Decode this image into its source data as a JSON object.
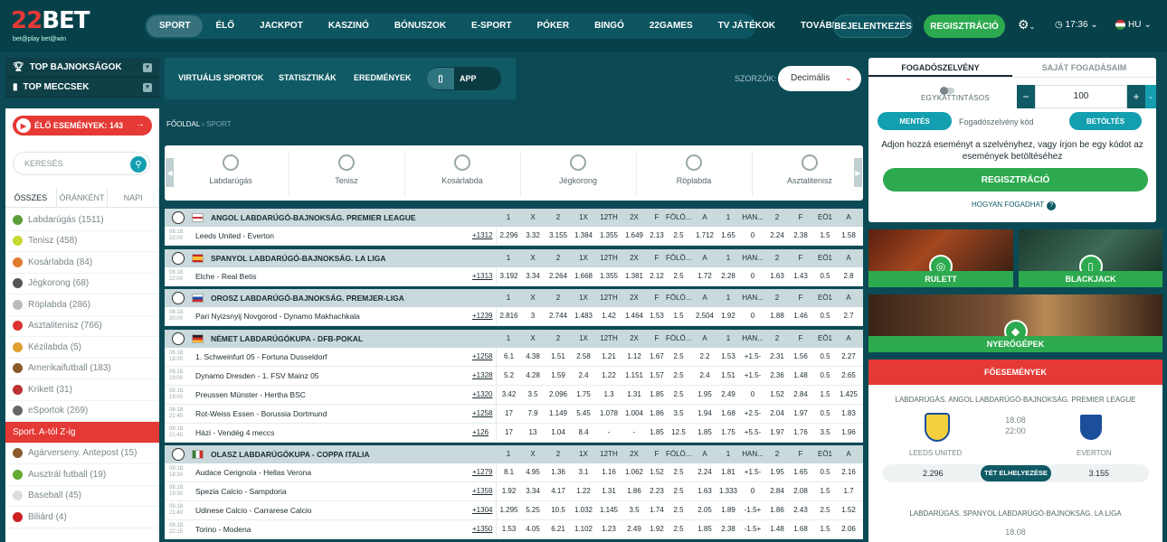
{
  "logo": {
    "text_z": "22",
    "text_bet": "BET",
    "tagline": "bet@play bet@win"
  },
  "nav": [
    "Sport",
    "Élő",
    "Jackpot",
    "Kaszinó",
    "Bónuszok",
    "E-Sport",
    "Póker",
    "Bingó",
    "22Games",
    "TV Játékok",
    "Tovább"
  ],
  "header": {
    "login": "BEJELENTKEZÉS",
    "register": "REGISZTRÁCIÓ",
    "time": "17:36",
    "lang": "HU"
  },
  "sidebar": {
    "top_leagues": "TOP BAJNOKSÁGOK",
    "top_matches": "TOP MECCSEK",
    "live_events": "ÉLŐ ESEMÉNYEK: 143",
    "search_placeholder": "KERESÉS",
    "tabs": [
      "ÖSSZES",
      "ÓRÁNKÉNT",
      "NAPI"
    ],
    "sports": [
      {
        "label": "Labdarúgás (1511)",
        "color": "#5e9e3a"
      },
      {
        "label": "Tenisz (458)",
        "color": "#c5d932"
      },
      {
        "label": "Kosárlabda (84)",
        "color": "#e07a2e"
      },
      {
        "label": "Jégkorong (68)",
        "color": "#555"
      },
      {
        "label": "Röplabda (286)",
        "color": "#bbb"
      },
      {
        "label": "Asztalitenisz (766)",
        "color": "#d33"
      },
      {
        "label": "Kézilabda (5)",
        "color": "#e0a030"
      },
      {
        "label": "Amerikaifutball (183)",
        "color": "#8b5a2b"
      },
      {
        "label": "Krikett (31)",
        "color": "#b33"
      },
      {
        "label": "eSportok (269)",
        "color": "#666"
      }
    ],
    "az_label": "Sport. A-tól Z-ig",
    "sports2": [
      {
        "label": "Agárverseny. Antepost (15)",
        "color": "#8b5a2b"
      },
      {
        "label": "Ausztrál futball (19)",
        "color": "#6a3"
      },
      {
        "label": "Baseball (45)",
        "color": "#ddd"
      },
      {
        "label": "Biliárd (4)",
        "color": "#c22"
      }
    ]
  },
  "subnav": {
    "virtual": "VIRTUÁLIS SPORTOK",
    "stats": "STATISZTIKÁK",
    "results": "EREDMÉNYEK",
    "app": "APP"
  },
  "odds_format": {
    "label": "SZORZÓK:",
    "value": "Decimális"
  },
  "breadcrumb": {
    "home": "FŐOLDAL",
    "current": "SPORT"
  },
  "sport_tabs": [
    "Labdarúgás",
    "Tenisz",
    "Kosárlabda",
    "Jégkorong",
    "Röplabda",
    "Asztalitenisz"
  ],
  "col_headers": [
    "1",
    "X",
    "2",
    "1X",
    "12TH",
    "2X",
    "F",
    "FÖLÖ...",
    "A",
    "1",
    "HAN...",
    "2",
    "F",
    "EÖ1",
    "A"
  ],
  "leagues": [
    {
      "name": "ANGOL LABDARÚGÓ-BAJNOKSÁG. PREMIER LEAGUE",
      "flag": "en",
      "rows": [
        {
          "date": "08.18.",
          "time": "22:00",
          "teams": "Leeds United - Everton",
          "plus": "+1312",
          "odds": [
            "2.296",
            "3.32",
            "3.155",
            "1.384",
            "1.355",
            "1.649",
            "2.13",
            "2.5",
            "1.712",
            "1.65",
            "0",
            "2.24",
            "2.38",
            "1.5",
            "1.58"
          ]
        }
      ]
    },
    {
      "name": "SPANYOL LABDARÚGÓ-BAJNOKSÁG. LA LIGA",
      "flag": "es",
      "rows": [
        {
          "date": "08.18.",
          "time": "22:00",
          "teams": "Elche - Real Betis",
          "plus": "+1313",
          "odds": [
            "3.192",
            "3.34",
            "2.264",
            "1.668",
            "1.355",
            "1.381",
            "2.12",
            "2.5",
            "1.72",
            "2.28",
            "0",
            "1.63",
            "1.43",
            "0.5",
            "2.8"
          ]
        }
      ]
    },
    {
      "name": "OROSZ LABDARÚGÓ-BAJNOKSÁG. PREMJER-LIGA",
      "flag": "ru",
      "rows": [
        {
          "date": "08.18.",
          "time": "20:00",
          "teams": "Pari Nyizsnyij Novgorod - Dynamo Makhachkala",
          "plus": "+1239",
          "odds": [
            "2.816",
            "3",
            "2.744",
            "1.483",
            "1.42",
            "1.464",
            "1.53",
            "1.5",
            "2.504",
            "1.92",
            "0",
            "1.88",
            "1.46",
            "0.5",
            "2.7"
          ]
        }
      ]
    },
    {
      "name": "NÉMET LABDARÚGÓKUPA - DFB-POKAL",
      "flag": "de",
      "rows": [
        {
          "date": "08.18.",
          "time": "19:00",
          "teams": "1. Schweinfurt 05 - Fortuna Dusseldorf",
          "plus": "+1258",
          "odds": [
            "6.1",
            "4.38",
            "1.51",
            "2.58",
            "1.21",
            "1.12",
            "1.67",
            "2.5",
            "2.2",
            "1.53",
            "+1.5-",
            "2.31",
            "1.56",
            "0.5",
            "2.27"
          ]
        },
        {
          "date": "08.18.",
          "time": "19:00",
          "teams": "Dynamo Dresden - 1. FSV Mainz 05",
          "plus": "+1328",
          "odds": [
            "5.2",
            "4.28",
            "1.59",
            "2.4",
            "1.22",
            "1.151",
            "1.57",
            "2.5",
            "2.4",
            "1.51",
            "+1.5-",
            "2.36",
            "1.48",
            "0.5",
            "2.65"
          ]
        },
        {
          "date": "08.18.",
          "time": "19:00",
          "teams": "Preussen Münster - Hertha BSC",
          "plus": "+1320",
          "odds": [
            "3.42",
            "3.5",
            "2.096",
            "1.75",
            "1.3",
            "1.31",
            "1.85",
            "2.5",
            "1.95",
            "2.49",
            "0",
            "1.52",
            "2.84",
            "1.5",
            "1.425"
          ]
        },
        {
          "date": "08.18.",
          "time": "21:45",
          "teams": "Rot-Weiss Essen - Borussia Dortmund",
          "plus": "+1258",
          "odds": [
            "17",
            "7.9",
            "1.149",
            "5.45",
            "1.078",
            "1.004",
            "1.86",
            "3.5",
            "1.94",
            "1.68",
            "+2.5-",
            "2.04",
            "1.97",
            "0.5",
            "1.83"
          ]
        },
        {
          "date": "08.18.",
          "time": "21:45",
          "teams": "Házi - Vendég 4 meccs",
          "plus": "+126",
          "odds": [
            "17",
            "13",
            "1.04",
            "8.4",
            "-",
            "-",
            "1.85",
            "12.5",
            "1.85",
            "1.75",
            "+5.5-",
            "1.97",
            "1.76",
            "3.5",
            "1.96"
          ]
        }
      ]
    },
    {
      "name": "OLASZ LABDARÚGÓKUPA - COPPA ITALIA",
      "flag": "it",
      "rows": [
        {
          "date": "08.18.",
          "time": "18:30",
          "teams": "Audace Cerignola - Hellas Verona",
          "plus": "+1279",
          "odds": [
            "8.1",
            "4.95",
            "1.36",
            "3.1",
            "1.16",
            "1.062",
            "1.52",
            "2.5",
            "2.24",
            "1.81",
            "+1.5-",
            "1.95",
            "1.65",
            "0.5",
            "2.16"
          ]
        },
        {
          "date": "08.18.",
          "time": "19:30",
          "teams": "Spezia Calcio - Sampdoria",
          "plus": "+1359",
          "odds": [
            "1.92",
            "3.34",
            "4.17",
            "1.22",
            "1.31",
            "1.86",
            "2.23",
            "2.5",
            "1.63",
            "1.333",
            "0",
            "2.84",
            "2.08",
            "1.5",
            "1.7"
          ]
        },
        {
          "date": "08.18.",
          "time": "21:40",
          "teams": "Udinese Calcio - Carrarese Calcio",
          "plus": "+1304",
          "odds": [
            "1.295",
            "5.25",
            "10.5",
            "1.032",
            "1.145",
            "3.5",
            "1.74",
            "2.5",
            "2.05",
            "1.89",
            "-1.5+",
            "1.86",
            "2.43",
            "2.5",
            "1.52"
          ]
        },
        {
          "date": "08.18.",
          "time": "22:15",
          "teams": "Torino - Modena",
          "plus": "+1350",
          "odds": [
            "1.53",
            "4.05",
            "6.21",
            "1.102",
            "1.23",
            "2.49",
            "1.92",
            "2.5",
            "1.85",
            "2.38",
            "-1.5+",
            "1.48",
            "1.68",
            "1.5",
            "2.06"
          ]
        }
      ]
    }
  ],
  "betslip": {
    "tab1": "FOGADÓSZELVÉNY",
    "tab2": "SAJÁT FOGADÁSAIM",
    "one_click": "EGYKATTINTÁSOS",
    "stake": "100",
    "save": "MENTÉS",
    "code_label": "Fogadószelvény kód",
    "load": "BETÖLTÉS",
    "message": "Adjon hozzá eseményt a szelvényhez, vagy írjon be egy kódot az események betöltéséhez",
    "register": "REGISZTRÁCIÓ",
    "how": "HOGYAN FOGADHAT"
  },
  "casino": {
    "roulette": "RULETT",
    "blackjack": "BLACKJACK",
    "slots": "NYERŐGÉPEK"
  },
  "featured": {
    "title": "FŐESEMÉNYEK",
    "league1": "LABDARÚGÁS. ANGOL LABDARÚGÓ-BAJNOKSÁG. PREMIER LEAGUE",
    "date": "18.08",
    "time": "22:00",
    "home": "LEEDS UNITED",
    "away": "EVERTON",
    "odd1": "2.296",
    "odd2": "3.155",
    "place_bet": "TÉT ELHELYEZÉSE",
    "league2": "LABDARÚGÁS. SPANYOL LABDARÚGÓ-BAJNOKSÁG. LA LIGA",
    "date2": "18.08"
  }
}
